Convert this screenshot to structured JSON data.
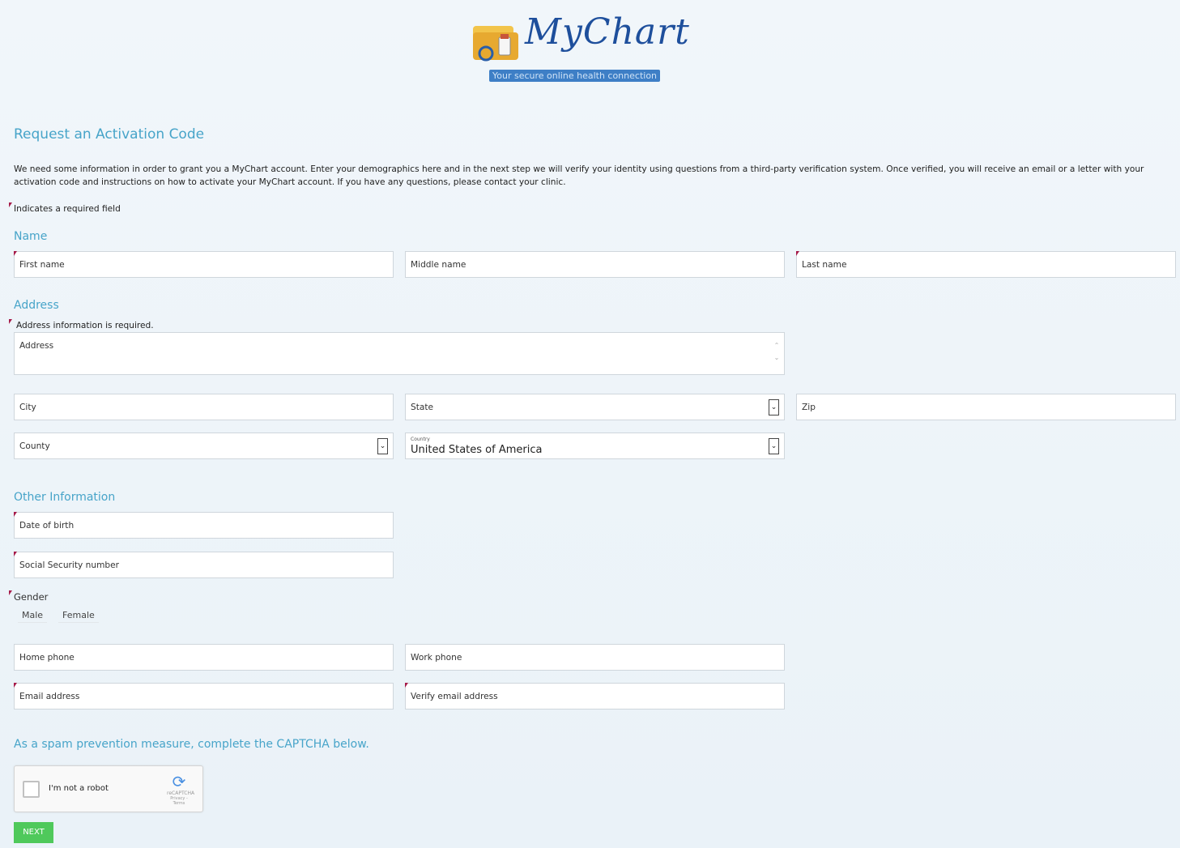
{
  "logo": {
    "name": "MyChart",
    "tagline": "Your secure online health connection"
  },
  "page_title": "Request an Activation Code",
  "intro": "We need some information in order to grant you a MyChart account. Enter your demographics here and in the next step we will verify your identity using questions from a third-party verification system. Once verified, you will receive an email or a letter with your activation code and instructions on how to activate your MyChart account. If you have any questions, please contact your clinic.",
  "required_note": "Indicates a required field",
  "name_section": {
    "title": "Name",
    "first": "First name",
    "middle": "Middle name",
    "last": "Last name"
  },
  "address_section": {
    "title": "Address",
    "required_note": "Address information is required.",
    "address": "Address",
    "city": "City",
    "state": "State",
    "zip": "Zip",
    "county": "County",
    "country_label": "Country",
    "country_value": "United States of America"
  },
  "other_section": {
    "title": "Other Information",
    "dob": "Date of birth",
    "ssn": "Social Security number",
    "gender_label": "Gender",
    "gender_male": "Male",
    "gender_female": "Female",
    "home_phone": "Home phone",
    "work_phone": "Work phone",
    "email": "Email address",
    "verify_email": "Verify email address"
  },
  "captcha": {
    "title": "As a spam prevention measure, complete the CAPTCHA below.",
    "checkbox_label": "I'm not a robot",
    "brand": "reCAPTCHA",
    "links": "Privacy - Terms"
  },
  "next_button": "NEXT",
  "colors": {
    "heading": "#47a4c9",
    "required_flag": "#a61c4a",
    "next_button": "#4fc95b",
    "logo": "#1e4f9c"
  }
}
